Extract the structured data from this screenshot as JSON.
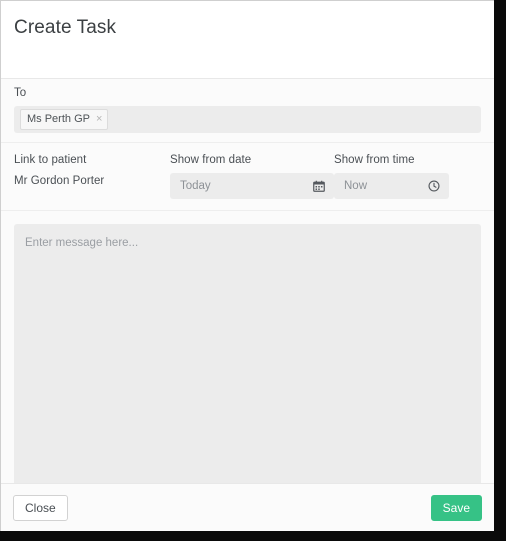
{
  "window": {
    "frame_color": "#0a0a0a",
    "dialog_background": "#ffffff"
  },
  "header": {
    "title": "Create Task"
  },
  "recipients": {
    "label": "To",
    "tokens": [
      {
        "name": "Ms Perth GP",
        "remove_icon": "close-x-icon",
        "remove_glyph": "×"
      }
    ],
    "input_placeholder": ""
  },
  "meta": {
    "patient": {
      "label": "Link to patient",
      "value": "Mr Gordon Porter"
    },
    "date": {
      "label": "Show from date",
      "value": "Today",
      "icon": "calendar-icon"
    },
    "time": {
      "label": "Show from time",
      "value": "Now",
      "icon": "clock-icon"
    }
  },
  "message": {
    "placeholder": "Enter message here...",
    "value": ""
  },
  "footer": {
    "close_label": "Close",
    "save_label": "Save",
    "save_color": "#36c286"
  }
}
